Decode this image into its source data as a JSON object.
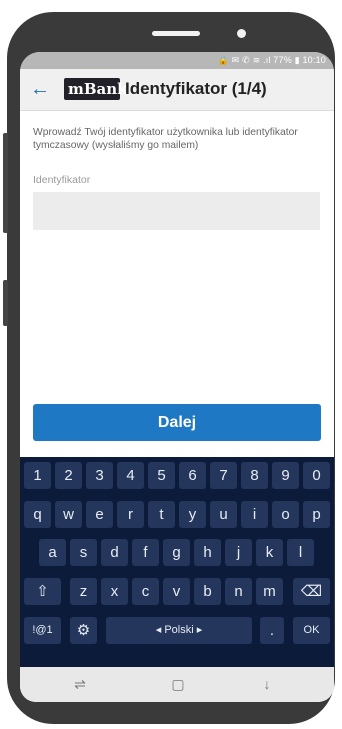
{
  "status_bar": {
    "text": "🔒 ✉ ✆ ≋ .ıl 77% ▮ 10:10"
  },
  "app_bar": {
    "back_icon": "arrow-left-icon",
    "logo_text": "mBank",
    "title": "Identyfikator (1/4)"
  },
  "content": {
    "description": "Wprowadź Twój identyfikator użytkownika lub identyfikator tymczasowy (wysłaliśmy go mailem)",
    "field_label": "Identyfikator",
    "field_value": "",
    "button_label": "Dalej"
  },
  "keyboard": {
    "row_numbers": [
      "1",
      "2",
      "3",
      "4",
      "5",
      "6",
      "7",
      "8",
      "9",
      "0"
    ],
    "row_top": [
      "q",
      "w",
      "e",
      "r",
      "t",
      "y",
      "u",
      "i",
      "o",
      "p"
    ],
    "row_mid": [
      "a",
      "s",
      "d",
      "f",
      "g",
      "h",
      "j",
      "k",
      "l"
    ],
    "row_bottom": [
      "z",
      "x",
      "c",
      "v",
      "b",
      "n",
      "m"
    ],
    "shift_glyph": "⇧",
    "backspace_glyph": "⌫",
    "symbols_label": "!@1",
    "settings_glyph": "⚙",
    "space_label": "◂ Polski ▸",
    "period_label": ".",
    "ok_label": "OK"
  },
  "nav_bar": {
    "recent_glyph": "⇌",
    "home_glyph": "▢",
    "back_glyph": "↓"
  },
  "colors": {
    "accent": "#1f78c4",
    "keyboard_bg": "#0d1b3a",
    "key_bg": "#24365c"
  }
}
